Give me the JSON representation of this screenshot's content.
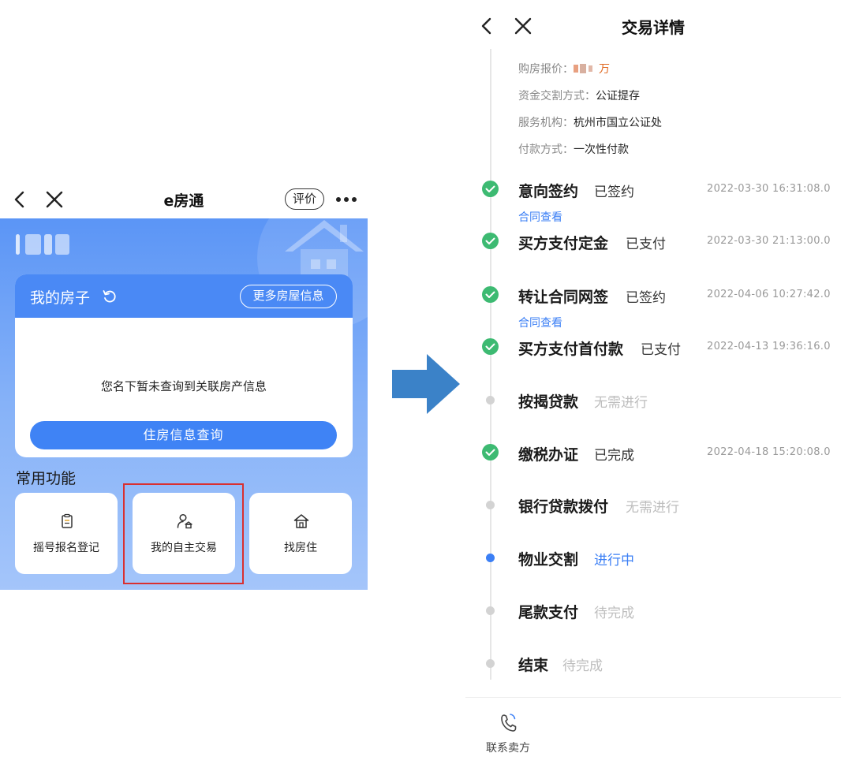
{
  "left_screen": {
    "nav": {
      "title": "e房通",
      "rate_label": "评价"
    },
    "house_card": {
      "title": "我的房子",
      "more_info_label": "更多房屋信息",
      "empty_text": "您名下暂未查询到关联房产信息",
      "query_button": "住房信息查询"
    },
    "common_functions": {
      "title": "常用功能",
      "items": [
        {
          "label": "摇号报名登记",
          "icon": "clipboard-icon"
        },
        {
          "label": "我的自主交易",
          "icon": "user-house-icon"
        },
        {
          "label": "找房住",
          "icon": "house-icon"
        }
      ]
    }
  },
  "right_screen": {
    "nav": {
      "title": "交易详情"
    },
    "info": {
      "price_label": "购房报价：",
      "price_unit": "万",
      "fund_label": "资金交割方式：",
      "fund_value": "公证提存",
      "agency_label": "服务机构：",
      "agency_value": "杭州市国立公证处",
      "payment_label": "付款方式：",
      "payment_value": "一次性付款"
    },
    "steps": [
      {
        "name": "意向签约",
        "status": "已签约",
        "time": "2022-03-30 16:31:08.0",
        "link": "合同查看",
        "state": "done"
      },
      {
        "name": "买方支付定金",
        "status": "已支付",
        "time": "2022-03-30 21:13:00.0",
        "state": "done"
      },
      {
        "name": "转让合同网签",
        "status": "已签约",
        "time": "2022-04-06 10:27:42.0",
        "link": "合同查看",
        "state": "done"
      },
      {
        "name": "买方支付首付款",
        "status": "已支付",
        "time": "2022-04-13 19:36:16.0",
        "state": "done"
      },
      {
        "name": "按揭贷款",
        "status": "无需进行",
        "state": "skipped"
      },
      {
        "name": "缴税办证",
        "status": "已完成",
        "time": "2022-04-18 15:20:08.0",
        "state": "done"
      },
      {
        "name": "银行贷款拨付",
        "status": "无需进行",
        "state": "skipped"
      },
      {
        "name": "物业交割",
        "status": "进行中",
        "state": "in-progress"
      },
      {
        "name": "尾款支付",
        "status": "待完成",
        "state": "pending"
      },
      {
        "name": "结束",
        "status": "待完成",
        "state": "pending"
      }
    ],
    "footer": {
      "contact_label": "联系卖方"
    }
  },
  "colors": {
    "primary_blue": "#3f83f5",
    "done_green": "#3dba72",
    "pending_grey": "#bdbdbd",
    "price_orange": "#e0671f",
    "highlight_red": "#d93030",
    "arrow_blue": "#3b82c8"
  }
}
